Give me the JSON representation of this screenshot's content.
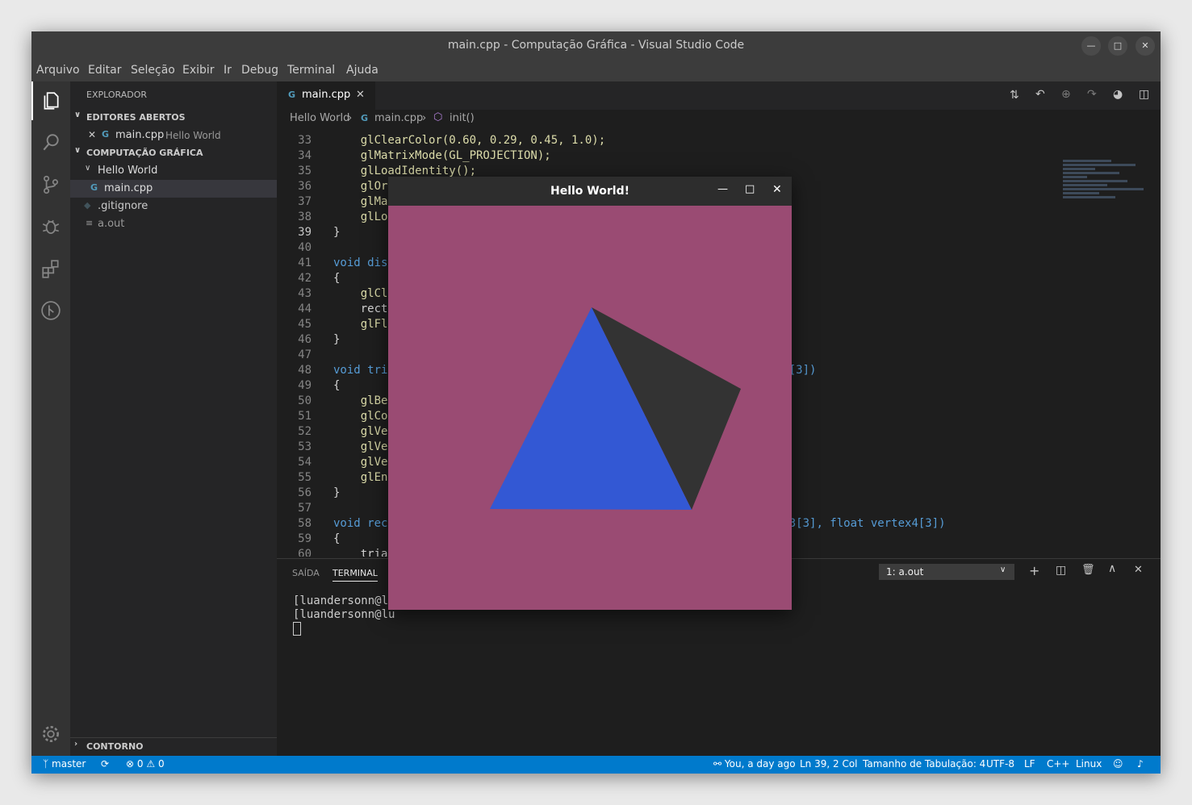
{
  "window": {
    "title": "main.cpp - Computação Gráfica - Visual Studio Code"
  },
  "menu": [
    "Arquivo",
    "Editar",
    "Seleção",
    "Exibir",
    "Ir",
    "Debug",
    "Terminal",
    "Ajuda"
  ],
  "activity_icons": [
    "files-icon",
    "search-icon",
    "source-control-icon",
    "debug-icon",
    "extensions-icon",
    "git-graph-icon"
  ],
  "sidebar": {
    "header": "EXPLORADOR",
    "open_editors": {
      "title": "EDITORES ABERTOS",
      "items": [
        {
          "name": "main.cpp",
          "folder": "Hello World"
        }
      ]
    },
    "project": {
      "title": "COMPUTAÇÃO GRÁFICA",
      "folder": "Hello World",
      "files": [
        "main.cpp",
        ".gitignore",
        "a.out"
      ]
    },
    "outline": "CONTORNO"
  },
  "editor": {
    "tab": "main.cpp",
    "breadcrumb": [
      "Hello World",
      "main.cpp",
      "init()"
    ],
    "lines": [
      {
        "n": "33",
        "code": "    glClearColor(0.60, 0.29, 0.45, 1.0);"
      },
      {
        "n": "34",
        "code": "    glMatrixMode(GL_PROJECTION);"
      },
      {
        "n": "35",
        "code": "    glLoadIdentity();"
      },
      {
        "n": "36",
        "code": "    glOr"
      },
      {
        "n": "37",
        "code": "    glMa"
      },
      {
        "n": "38",
        "code": "    glLo"
      },
      {
        "n": "39",
        "code": "}"
      },
      {
        "n": "40",
        "code": ""
      },
      {
        "n": "41",
        "code": "void dis"
      },
      {
        "n": "42",
        "code": "{"
      },
      {
        "n": "43",
        "code": "    glCl"
      },
      {
        "n": "44",
        "code": "    rect                                                s[3]);"
      },
      {
        "n": "45",
        "code": "    glFl"
      },
      {
        "n": "46",
        "code": "}"
      },
      {
        "n": "47",
        "code": ""
      },
      {
        "n": "48",
        "code": "void tri                                               loat vertex3[3])"
      },
      {
        "n": "49",
        "code": "{"
      },
      {
        "n": "50",
        "code": "    glBe"
      },
      {
        "n": "51",
        "code": "    glCo"
      },
      {
        "n": "52",
        "code": "    glVe"
      },
      {
        "n": "53",
        "code": "    glVe"
      },
      {
        "n": "54",
        "code": "    glVe"
      },
      {
        "n": "55",
        "code": "    glEn"
      },
      {
        "n": "56",
        "code": "}"
      },
      {
        "n": "57",
        "code": ""
      },
      {
        "n": "58",
        "code": "void rec                                               float vertex3[3], float vertex4[3])"
      },
      {
        "n": "59",
        "code": "{"
      },
      {
        "n": "60",
        "code": "    tria"
      }
    ]
  },
  "panel": {
    "tabs": [
      "SAÍDA",
      "TERMINAL"
    ],
    "terminal_select": "1: a.out",
    "terminal_lines": [
      "[luandersonn@lu                                         o\" -lGL -lglut",
      "[luandersonn@lu"
    ]
  },
  "statusbar": {
    "branch": "master",
    "errors": "0",
    "warnings": "0",
    "blame": "You, a day ago",
    "position": "Ln 39, 2 Col",
    "tab_size": "Tamanho de Tabulação: 4",
    "encoding": "UTF-8",
    "eol": "LF",
    "language": "C++",
    "os": "Linux"
  },
  "gl_window": {
    "title": "Hello World!",
    "background": "#9a4b73",
    "triangle_colors": [
      "#3358d4",
      "#333333"
    ]
  },
  "colors": {
    "accent": "#007acc",
    "keyword": "#569cd6",
    "function": "#dcdcaa",
    "number": "#b5cea8",
    "constant": "#4fc1ff"
  }
}
